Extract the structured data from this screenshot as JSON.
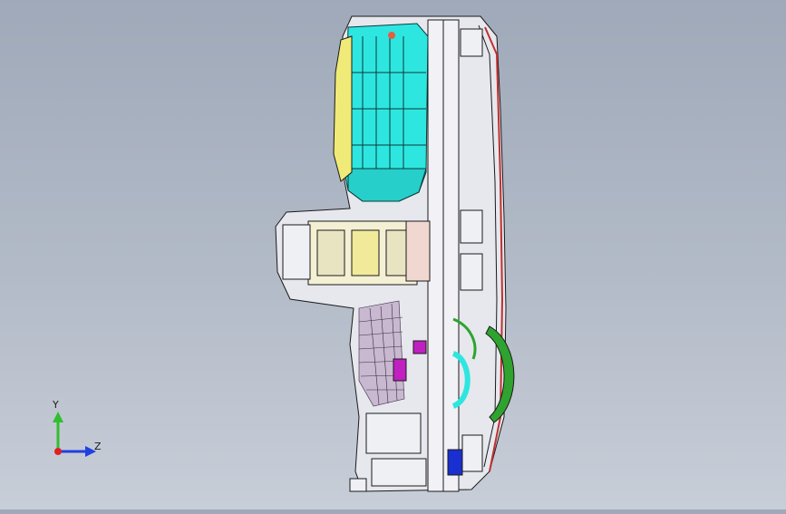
{
  "scene": {
    "background_top": "#9fa9b9",
    "background_bottom": "#c8ced8",
    "model_description_colors": {
      "cyan_housing": "#2ee6e0",
      "yellow_part": "#f0ea78",
      "green_part": "#2fa32f",
      "magenta_part": "#c020c0",
      "blue_part": "#1a2fd0",
      "red_part": "#e02020",
      "outline": "#1a1a1a",
      "body_fill": "#e8eaf0"
    }
  },
  "triad": {
    "y_label": "Y",
    "z_label": "Z",
    "y_color": "#2fbf2f",
    "z_color": "#2040e0",
    "x_color": "#e02020"
  }
}
